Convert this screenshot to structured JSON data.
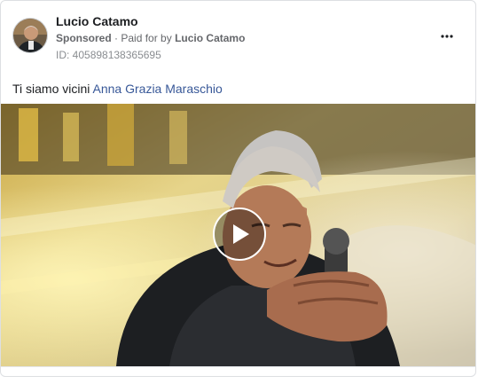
{
  "post": {
    "author_name": "Lucio Catamo",
    "sponsored_label": "Sponsored",
    "paid_for_prefix": "Paid for by",
    "paid_for_name": "Lucio Catamo",
    "ad_id": "ID: 405898138365695",
    "caption_text": "Ti siamo vicini ",
    "caption_mention": "Anna Grazia Maraschio"
  },
  "icons": {
    "more": "more-options-icon",
    "play": "play-icon",
    "avatar": "avatar"
  },
  "colors": {
    "link": "#385898",
    "secondary_text": "#65676b",
    "primary_text": "#1c1e21"
  }
}
